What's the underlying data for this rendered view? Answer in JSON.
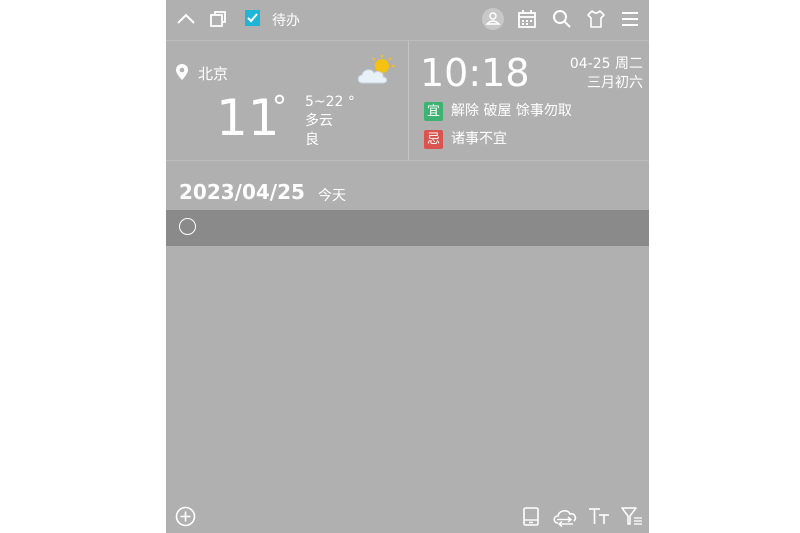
{
  "header": {
    "app_title": "待办",
    "icons": [
      "collapse-icon",
      "pin-window-icon",
      "todo-app-icon",
      "account-icon",
      "calendar-icon",
      "search-icon",
      "skin-icon",
      "menu-icon"
    ]
  },
  "weather": {
    "city": "北京",
    "temperature": "11",
    "degree_symbol": "°",
    "range": "5~22 °",
    "condition": "多云",
    "air_quality": "良",
    "icon": "partly-cloudy-icon"
  },
  "clock": {
    "time": "10:18",
    "date": "04-25 周二",
    "lunar_date": "三月初六",
    "auspicious": {
      "badge": "宜",
      "text": "解除 破屋 馀事勿取",
      "color": "#3cb371"
    },
    "inauspicious": {
      "badge": "忌",
      "text": "诸事不宜",
      "color": "#d9534f"
    }
  },
  "list": {
    "date": "2023/04/25",
    "day_label": "今天",
    "new_task_value": ""
  },
  "footer": {
    "icons": [
      "add-icon",
      "tablet-icon",
      "cloud-sync-icon",
      "font-size-icon",
      "filter-list-icon"
    ]
  },
  "colors": {
    "panel_bg": "#b0b0b0",
    "row_highlight": "#8a8a8a",
    "text": "#ffffff",
    "app_icon": "#1fb5d6"
  }
}
